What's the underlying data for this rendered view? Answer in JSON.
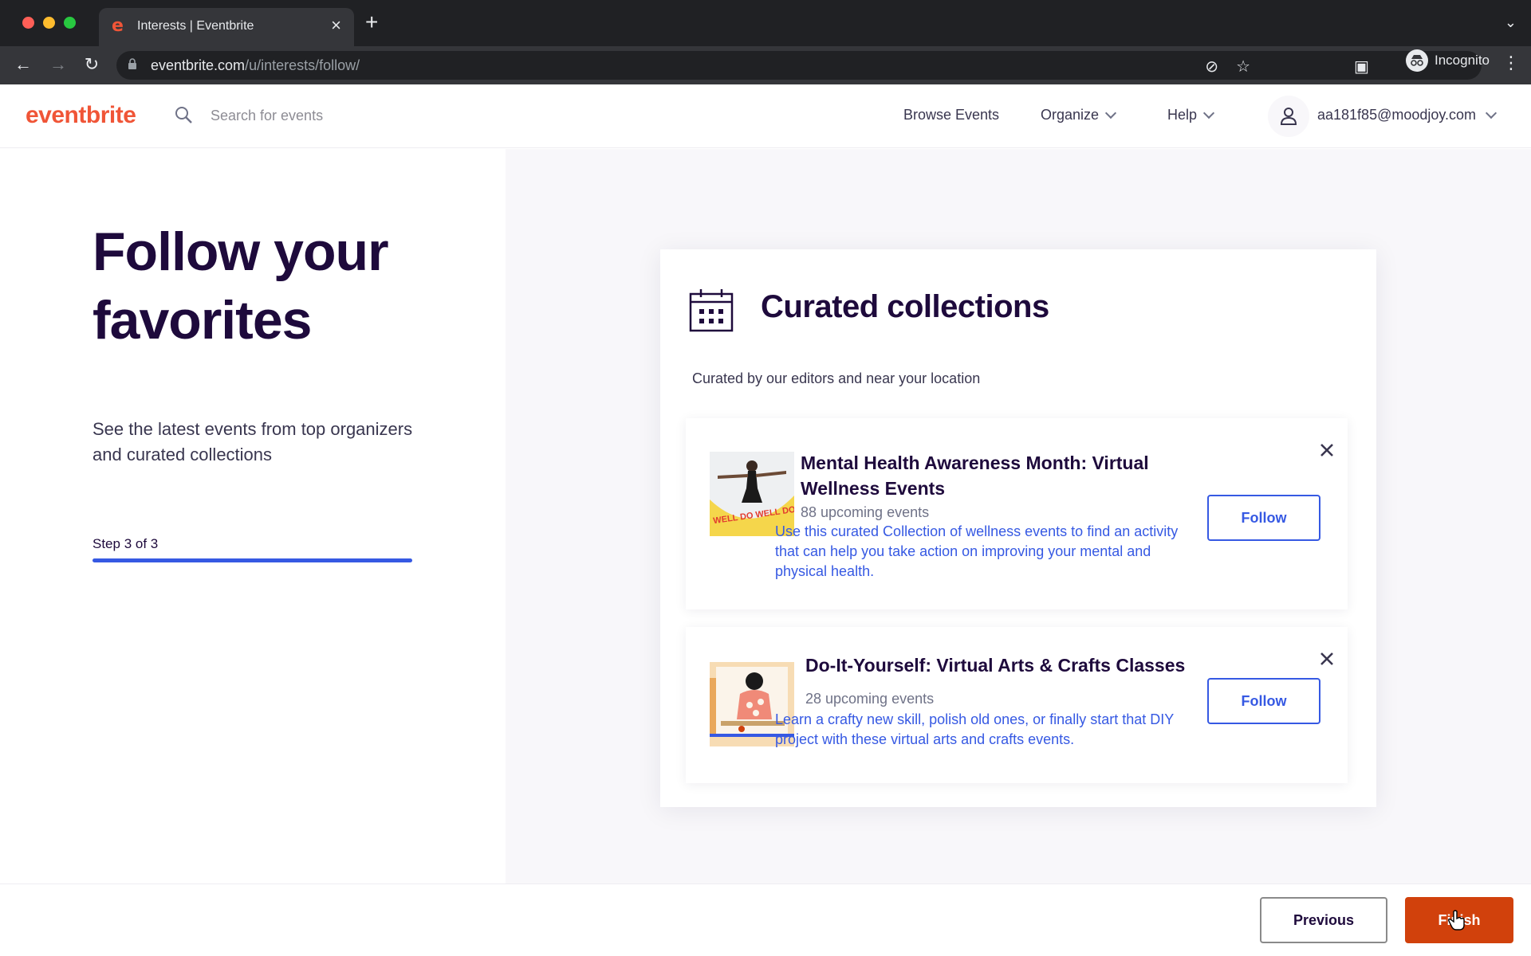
{
  "browser": {
    "tab_title": "Interests | Eventbrite",
    "url_domain": "eventbrite.com",
    "url_path": "/u/interests/follow/",
    "incognito_label": "Incognito",
    "traffic_colors": [
      "#ff5f57",
      "#febc2e",
      "#28c840"
    ]
  },
  "header": {
    "logo": "eventbrite",
    "search_placeholder": "Search for events",
    "nav": {
      "browse": "Browse Events",
      "organize": "Organize",
      "help": "Help"
    },
    "account_email": "aa181f85@moodjoy.com"
  },
  "left": {
    "title": "Follow your favorites",
    "subtitle": "See the latest events from top organizers and curated collections",
    "step_label": "Step 3 of 3",
    "progress": 1.0
  },
  "card": {
    "title": "Curated collections",
    "subtitle": "Curated by our editors and near your location",
    "collections": [
      {
        "title": "Mental Health Awareness Month: Virtual Wellness Events",
        "count": "88 upcoming events",
        "description": "Use this curated Collection of wellness events to find an activity that can help you take action on improving your mental and physical health.",
        "follow_label": "Follow",
        "image_text": "WELL DO WELL DO"
      },
      {
        "title": "Do-It-Yourself: Virtual Arts & Crafts Classes",
        "count": "28 upcoming events",
        "description": "Learn a crafty new skill, polish old ones, or finally start that DIY project with these virtual arts and crafts events.",
        "follow_label": "Follow"
      }
    ]
  },
  "footer": {
    "previous_label": "Previous",
    "finish_label": "Finish"
  },
  "colors": {
    "brand": "#f05537",
    "accent_blue": "#3659e3",
    "finish": "#d1410c",
    "heading": "#1e0a3c"
  }
}
